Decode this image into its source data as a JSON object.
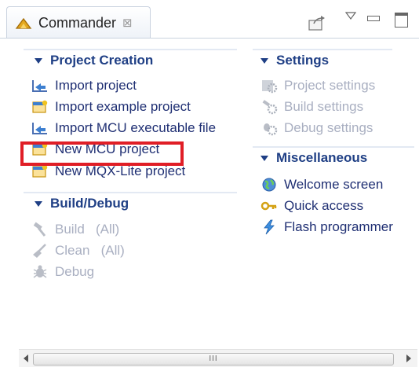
{
  "tab": {
    "title": "Commander",
    "close_glyph": "⊠"
  },
  "sections": {
    "project_creation": {
      "title": "Project Creation",
      "items": [
        {
          "label": "Import project",
          "icon": "import-project-icon",
          "enabled": true
        },
        {
          "label": "Import example project",
          "icon": "example-project-icon",
          "enabled": true
        },
        {
          "label": "Import MCU executable file",
          "icon": "import-executable-icon",
          "enabled": true
        },
        {
          "label": "New MCU project",
          "icon": "new-mcu-project-icon",
          "enabled": true,
          "highlighted": true
        },
        {
          "label": "New MQX-Lite project",
          "icon": "new-mqx-project-icon",
          "enabled": true
        }
      ]
    },
    "build_debug": {
      "title": "Build/Debug",
      "items": [
        {
          "label": "Build   (All)",
          "icon": "hammer-icon",
          "enabled": false
        },
        {
          "label": "Clean   (All)",
          "icon": "broom-icon",
          "enabled": false
        },
        {
          "label": "Debug",
          "icon": "bug-icon",
          "enabled": false
        }
      ]
    },
    "settings": {
      "title": "Settings",
      "items": [
        {
          "label": "Project settings",
          "icon": "project-settings-icon",
          "enabled": false
        },
        {
          "label": "Build settings",
          "icon": "build-settings-icon",
          "enabled": false
        },
        {
          "label": "Debug settings",
          "icon": "debug-settings-icon",
          "enabled": false
        }
      ]
    },
    "miscellaneous": {
      "title": "Miscellaneous",
      "items": [
        {
          "label": "Welcome screen",
          "icon": "welcome-globe-icon",
          "enabled": true
        },
        {
          "label": "Quick access",
          "icon": "key-icon",
          "enabled": true
        },
        {
          "label": "Flash programmer",
          "icon": "lightning-icon",
          "enabled": true
        }
      ]
    }
  },
  "scrollbar": {
    "thumb_grip": "III"
  },
  "colors": {
    "section_title": "#1f3f85",
    "link": "#1f2f73",
    "disabled": "#a9afc1",
    "highlight_border": "#e01e26"
  }
}
